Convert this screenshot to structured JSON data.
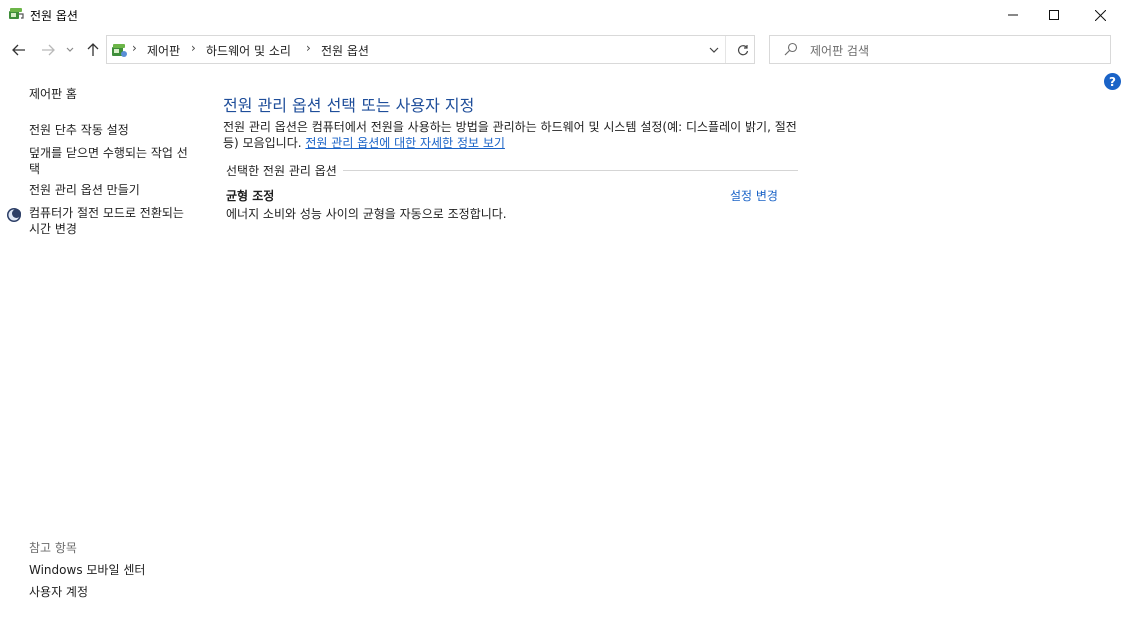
{
  "window": {
    "title": "전원 옵션"
  },
  "nav": {
    "breadcrumbs": [
      "제어판",
      "하드웨어 및 소리",
      "전원 옵션"
    ],
    "search_placeholder": "제어판 검색"
  },
  "left_pane": {
    "home": "제어판 홈",
    "links": [
      "전원 단추 작동 설정",
      "덮개를 닫으면 수행되는 작업 선택",
      "전원 관리 옵션 만들기",
      "컴퓨터가 절전 모드로 전환되는 시간 변경"
    ],
    "see_also_label": "참고 항목",
    "see_also": [
      "Windows 모바일 센터",
      "사용자 계정"
    ]
  },
  "main": {
    "title": "전원 관리 옵션 선택 또는 사용자 지정",
    "description": "전원 관리 옵션은 컴퓨터에서 전원을 사용하는 방법을 관리하는 하드웨어 및 시스템 설정(예: 디스플레이 밝기, 절전 등) 모음입니다.",
    "info_link": "전원 관리 옵션에 대한 자세한 정보 보기",
    "group_label": "선택한 전원 관리 옵션",
    "plan": {
      "name": "균형 조정",
      "description": "에너지 소비와 성능 사이의 균형을 자동으로 조정합니다.",
      "change_link": "설정 변경"
    }
  },
  "colors": {
    "link": "#1a63c7",
    "title": "#1f4e9a",
    "help": "#1a63c7"
  }
}
